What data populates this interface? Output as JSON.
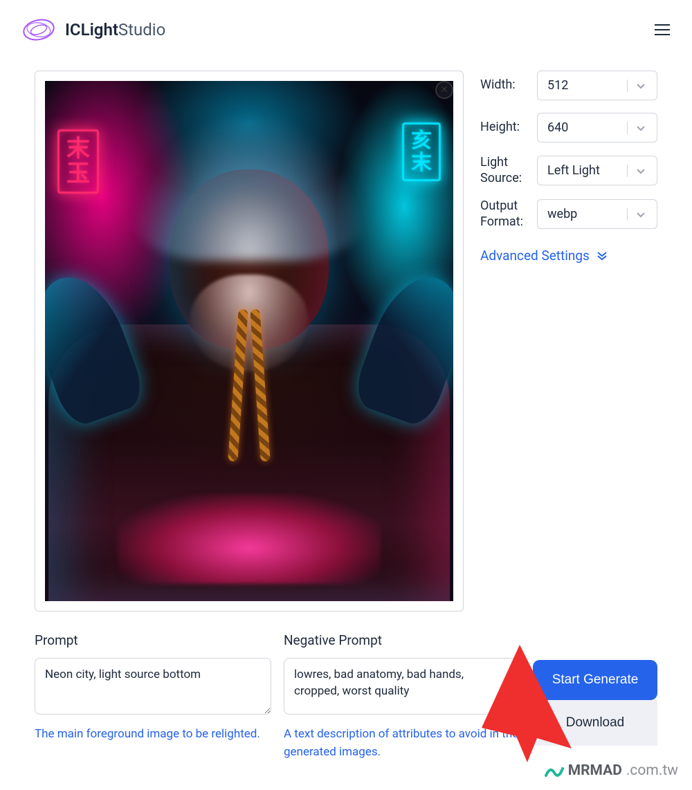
{
  "brand": {
    "name_bold": "ICLight",
    "name_light": "Studio"
  },
  "controls": {
    "width": {
      "label": "Width:",
      "value": "512"
    },
    "height": {
      "label": "Height:",
      "value": "640"
    },
    "light_source": {
      "label": "Light Source:",
      "value": "Left Light"
    },
    "output_format": {
      "label": "Output Format:",
      "value": "webp"
    },
    "advanced": "Advanced Settings"
  },
  "signs": {
    "left": "末\n玉",
    "right": "亥\n末"
  },
  "prompt": {
    "label": "Prompt",
    "value": "Neon city, light source bottom",
    "help": "The main foreground image to be relighted."
  },
  "negative": {
    "label": "Negative Prompt",
    "value": "lowres, bad anatomy, bad hands, cropped, worst quality",
    "help": "A text description of attributes to avoid in the generated images."
  },
  "actions": {
    "generate": "Start Generate",
    "download": "Download"
  },
  "watermark": {
    "brand": "MRMAD",
    "suffix": ".com.tw"
  }
}
